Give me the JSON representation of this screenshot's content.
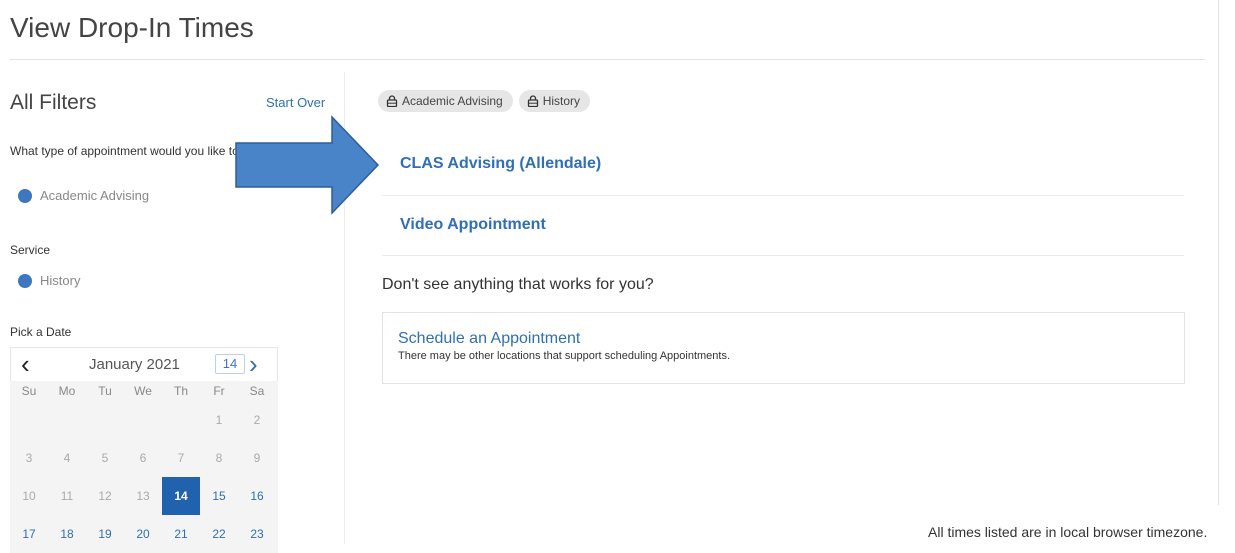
{
  "page": {
    "title": "View Drop-In Times"
  },
  "filters": {
    "heading": "All Filters",
    "start_over": "Start Over",
    "question": "What type of appointment would you like to schedule?",
    "appointment_type": "Academic Advising",
    "service_label": "Service",
    "service": "History",
    "date_label": "Pick a Date"
  },
  "calendar": {
    "month": "January 2021",
    "today": "14",
    "weekdays": [
      "Su",
      "Mo",
      "Tu",
      "We",
      "Th",
      "Fr",
      "Sa"
    ],
    "weeks": [
      [
        "",
        "",
        "",
        "",
        "",
        "1",
        "2"
      ],
      [
        "3",
        "4",
        "5",
        "6",
        "7",
        "8",
        "9"
      ],
      [
        "10",
        "11",
        "12",
        "13",
        "14",
        "15",
        "16"
      ],
      [
        "17",
        "18",
        "19",
        "20",
        "21",
        "22",
        "23"
      ]
    ],
    "selected": "14",
    "available": [
      "15",
      "16",
      "17",
      "18",
      "19",
      "20",
      "21",
      "22",
      "23"
    ]
  },
  "chips": [
    "Academic Advising",
    "History"
  ],
  "results": [
    "CLAS Advising (Allendale)",
    "Video Appointment"
  ],
  "fallback": {
    "prompt": "Don't see anything that works for you?",
    "title": "Schedule an Appointment",
    "subtitle": "There may be other locations that support scheduling Appointments."
  },
  "timezone_note": "All times listed are in local browser timezone.",
  "colors": {
    "accent": "#2f6fb5",
    "selected_day": "#2062ad",
    "arrow_fill": "#4a84c8"
  }
}
